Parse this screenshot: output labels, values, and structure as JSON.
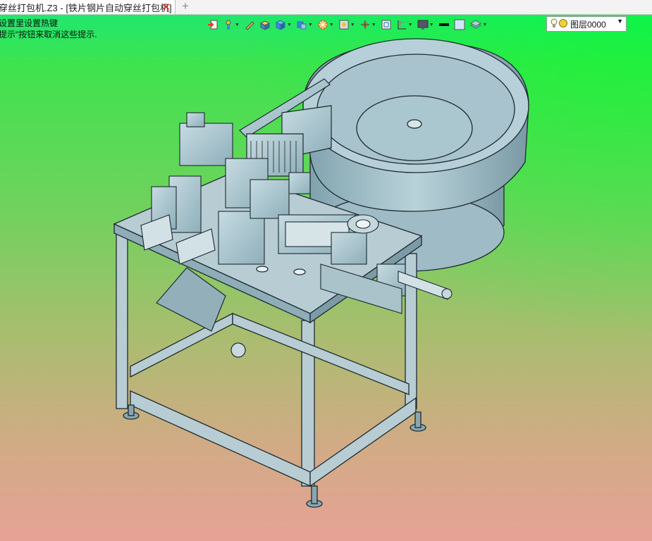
{
  "tab": {
    "title": "穿丝打包机.Z3 - [铁片钢片自动穿丝打包机]",
    "close_icon": "close-icon",
    "add_icon": "plus-icon"
  },
  "hints": {
    "line1": "设置里设置热键",
    "line2": "提示\"按钮来取消这些提示."
  },
  "toolbar": {
    "icons": [
      "import-icon",
      "move-icon",
      "pencil-icon",
      "box-icon",
      "cube-icon",
      "shaded-cube-icon",
      "orange-wheel-icon",
      "view-icon",
      "axis-icon",
      "frame-icon",
      "grid-icon",
      "monitor-icon",
      "line-color-icon",
      "fill-color-icon",
      "layer-stack-icon"
    ],
    "layer_name": "图层0000"
  },
  "colors": {
    "bg_top": "#17e977",
    "bg_bottom": "#e6a296",
    "model_fill": "#a9c6d0",
    "model_edge": "#1d2a30"
  }
}
